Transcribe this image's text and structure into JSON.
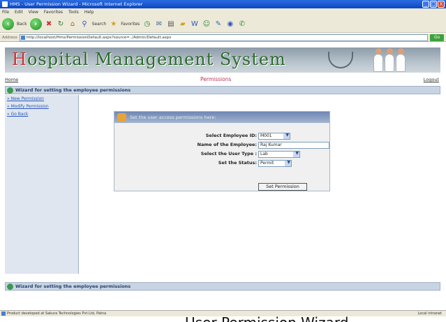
{
  "window": {
    "title": "HMS - User Permission Wizard - Microsoft Internet Explorer",
    "controls": [
      "_",
      "□",
      "X"
    ]
  },
  "menu": [
    "File",
    "Edit",
    "View",
    "Favorites",
    "Tools",
    "Help"
  ],
  "toolbar": {
    "back_label": "Back",
    "search_label": "Search",
    "favorites_label": "Favorites"
  },
  "address": {
    "label": "Address",
    "url": "http://localhost/Hms/PermissionDefault.aspx?source=../Admin/Default.aspx",
    "go_label": "Go"
  },
  "header": {
    "logo_text": "ospital  Management  System",
    "logo_cross": "H"
  },
  "nav": {
    "home": "Home",
    "page_title": "Permissions",
    "logout": "Logout"
  },
  "wizard": {
    "title": "Wizard for setting the employee permissions",
    "footer_title": "Wizard for setting the employee permissions"
  },
  "sidebar": {
    "items": [
      {
        "label": "» New Permission"
      },
      {
        "label": "» Modify Permission"
      },
      {
        "label": "» Go Back"
      }
    ]
  },
  "form": {
    "heading": "Set the user access permissions here:",
    "employee_id_label": "Select Employee ID:",
    "employee_id_value": "M001",
    "employee_name_label": "Name of the Employee:",
    "employee_name_value": "Raj Kumar",
    "user_type_label": "Select the User Type :",
    "user_type_value": "Lab",
    "status_label": "Set the Status:",
    "status_value": "Permit",
    "submit_label": "Set Permission"
  },
  "status": {
    "text": "Product developed at Sakura Technologies Pvt Ltd, Patna",
    "zone": "Local intranet"
  },
  "caption": "User Permission Wizard"
}
